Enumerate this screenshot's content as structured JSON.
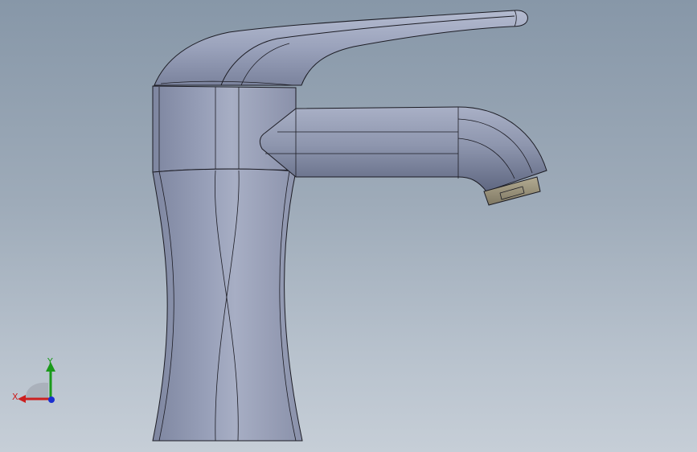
{
  "viewport": {
    "background_top": "#8797a8",
    "background_bottom": "#c6ced7"
  },
  "model": {
    "body_color": "#8f97b0",
    "edge_color": "#1c1c24",
    "aerator_color": "#9a927c"
  },
  "triad": {
    "x_label": "X",
    "y_label": "Y",
    "x_color": "#cc1f1f",
    "y_color": "#1a9a1a",
    "z_color": "#1a2fd0"
  }
}
